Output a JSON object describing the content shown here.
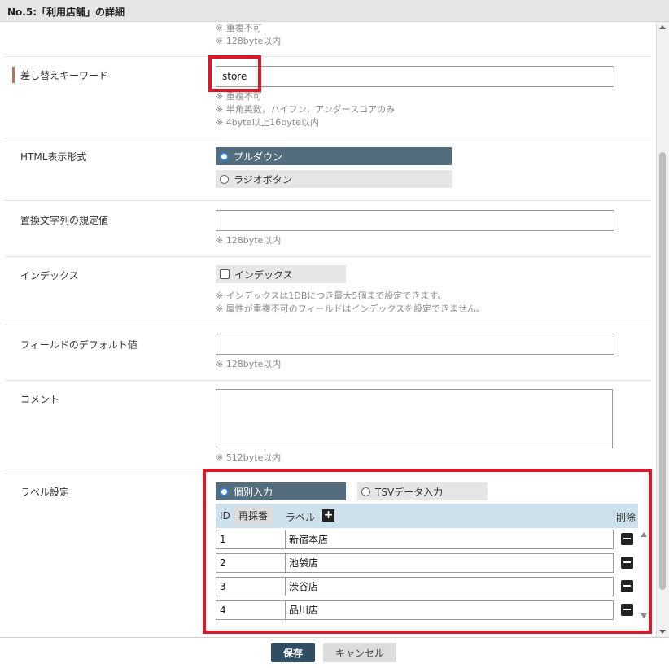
{
  "window": {
    "title": "No.5:「利用店舗」の詳細"
  },
  "top_notes": [
    "※ 重複不可",
    "※ 128byte以内"
  ],
  "keyword": {
    "label": "差し替えキーワード",
    "value": "store",
    "notes": [
      "※ 重複不可",
      "※ 半角英数，ハイフン，アンダースコアのみ",
      "※ 4byte以上16byte以内"
    ]
  },
  "html_format": {
    "label": "HTML表示形式",
    "options": [
      {
        "label": "プルダウン",
        "selected": true
      },
      {
        "label": "ラジオボタン",
        "selected": false
      }
    ]
  },
  "default_replace": {
    "label": "置換文字列の規定値",
    "value": "",
    "note": "※ 128byte以内"
  },
  "index": {
    "label": "インデックス",
    "checkbox_label": "インデックス",
    "checked": false,
    "notes": [
      "※ インデックスは1DBにつき最大5個まで設定できます。",
      "※ 属性が重複不可のフィールドはインデックスを設定できません。"
    ]
  },
  "field_default": {
    "label": "フィールドのデフォルト値",
    "value": "",
    "note": "※ 128byte以内"
  },
  "comment": {
    "label": "コメント",
    "value": "",
    "note": "※ 512byte以内"
  },
  "label_settings": {
    "label": "ラベル設定",
    "modes": [
      {
        "label": "個別入力",
        "selected": true
      },
      {
        "label": "TSVデータ入力",
        "selected": false
      }
    ],
    "header": {
      "id": "ID",
      "resort": "再採番",
      "label": "ラベル",
      "delete": "削除"
    },
    "rows": [
      {
        "id": "1",
        "label": "新宿本店"
      },
      {
        "id": "2",
        "label": "池袋店"
      },
      {
        "id": "3",
        "label": "渋谷店"
      },
      {
        "id": "4",
        "label": "品川店"
      }
    ]
  },
  "footer": {
    "save": "保存",
    "cancel": "キャンセル"
  },
  "colors": {
    "highlight": "#d8192a",
    "selected_option": "#546d7d",
    "save_button": "#2f4e62",
    "table_header": "#cde1ec"
  }
}
